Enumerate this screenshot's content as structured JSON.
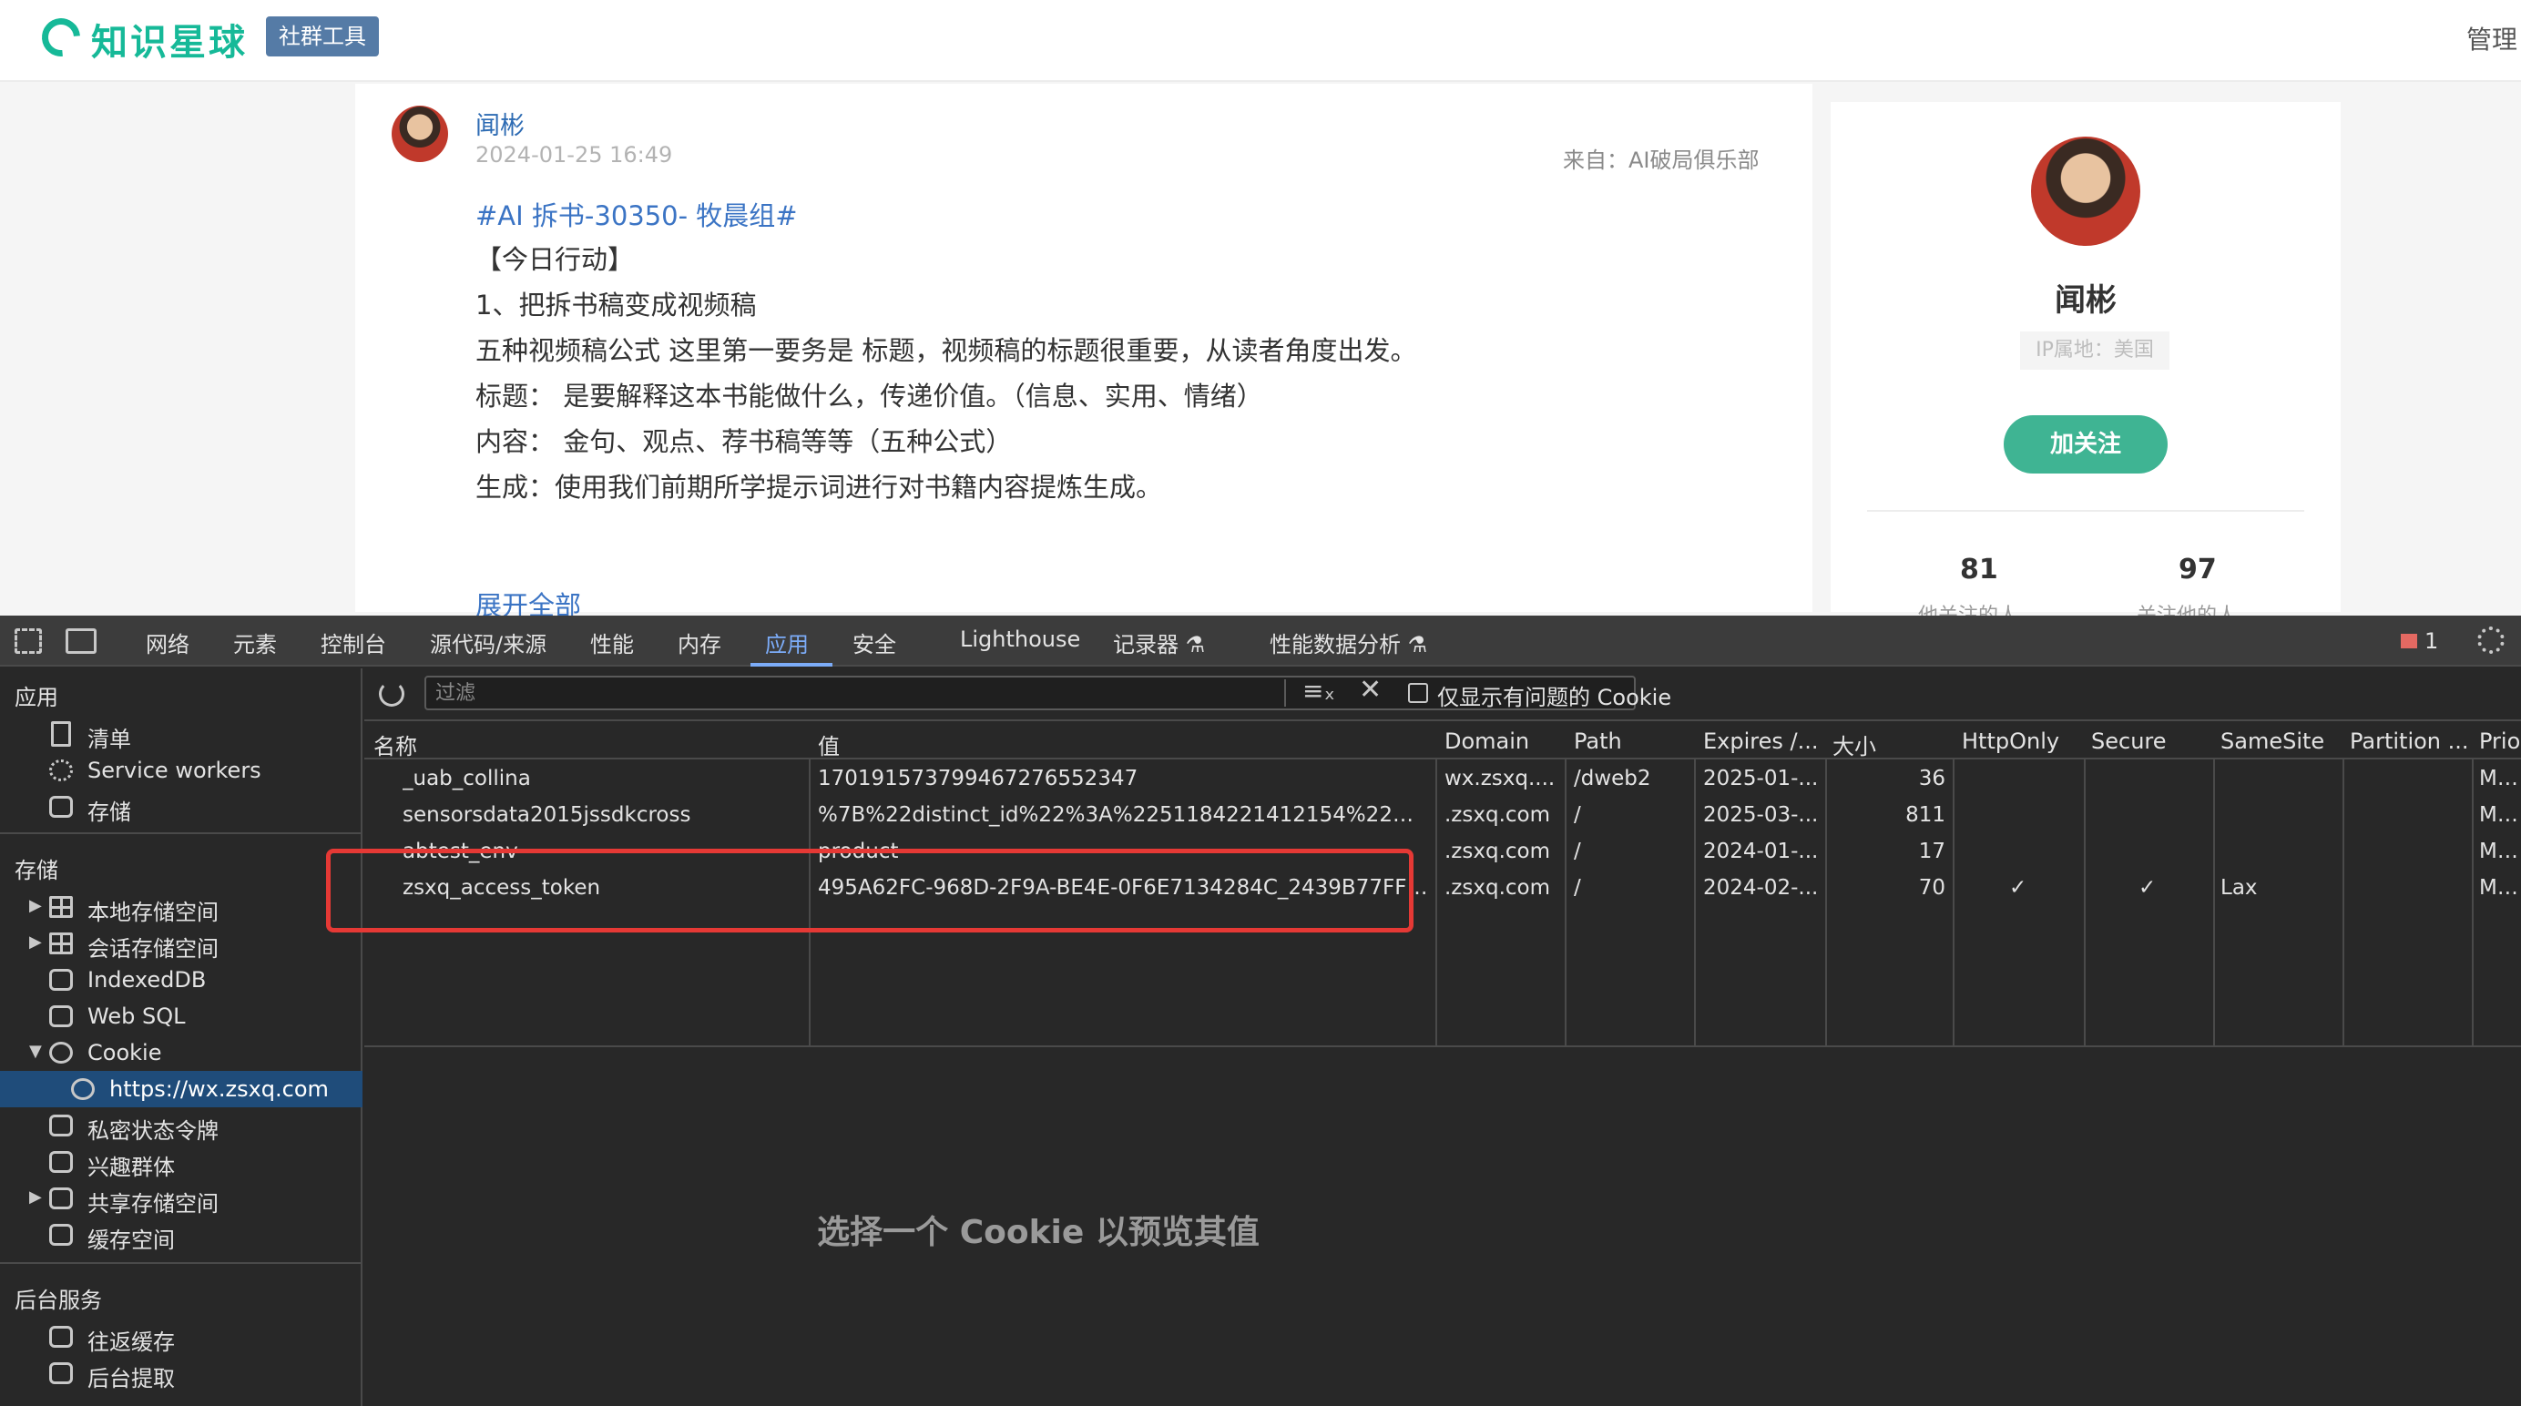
{
  "header": {
    "logo_text": "知识星球",
    "badge": "社群工具",
    "manage": "管理"
  },
  "post": {
    "author": "闻彬",
    "time": "2024-01-25 16:49",
    "source": "来自：AI破局俱乐部",
    "tag": "#AI 拆书-30350- 牧晨组#",
    "lines": [
      "【今日行动】",
      "1、把拆书稿变成视频稿",
      "五种视频稿公式 这里第一要务是 标题，视频稿的标题很重要，从读者角度出发。",
      "标题：  是要解释这本书能做什么，传递价值。（信息、实用、情绪）",
      "内容：  金句、观点、荐书稿等等（五种公式）",
      "生成：使用我们前期所学提示词进行对书籍内容提炼生成。"
    ],
    "expand": "展开全部"
  },
  "profile": {
    "name": "闻彬",
    "ip": "IP属地：美国",
    "follow": "加关注",
    "following_count": "81",
    "following_label": "他关注的人",
    "followers_count": "97",
    "followers_label": "关注他的人"
  },
  "devtools": {
    "tabs": [
      "网络",
      "元素",
      "控制台",
      "源代码/来源",
      "性能",
      "内存",
      "应用",
      "安全",
      "Lighthouse",
      "记录器 ⚗",
      "性能数据分析 ⚗"
    ],
    "active_tab": "应用",
    "issues": "1",
    "sidebar": {
      "app_head": "应用",
      "app_items": [
        "清单",
        "Service workers",
        "存储"
      ],
      "storage_head": "存储",
      "storage_items": [
        "本地存储空间",
        "会话存储空间",
        "IndexedDB",
        "Web SQL",
        "Cookie",
        "https://wx.zsxq.com",
        "私密状态令牌",
        "兴趣群体",
        "共享存储空间",
        "缓存空间"
      ],
      "bg_head": "后台服务",
      "bg_items": [
        "往返缓存",
        "后台提取"
      ]
    },
    "filter_placeholder": "过滤",
    "only_issues_label": "仅显示有问题的 Cookie",
    "columns": [
      "名称",
      "值",
      "Domain",
      "Path",
      "Expires /...",
      "大小",
      "HttpOnly",
      "Secure",
      "SameSite",
      "Partition ...",
      "Prior"
    ],
    "rows": [
      {
        "name": "_uab_collina",
        "value": "170191573799467276552347",
        "domain": "wx.zsxq....",
        "path": "/dweb2",
        "expires": "2025-01-...",
        "size": "36",
        "httponly": "",
        "secure": "",
        "samesite": "",
        "partition": "",
        "priority": "Med"
      },
      {
        "name": "sensorsdata2015jssdkcross",
        "value": "%7B%22distinct_id%22%3A%2251184221412154%22%2...",
        "domain": ".zsxq.com",
        "path": "/",
        "expires": "2025-03-...",
        "size": "811",
        "httponly": "",
        "secure": "",
        "samesite": "",
        "partition": "",
        "priority": "Med"
      },
      {
        "name": "abtest_env",
        "value": "product",
        "domain": ".zsxq.com",
        "path": "/",
        "expires": "2024-01-...",
        "size": "17",
        "httponly": "",
        "secure": "",
        "samesite": "",
        "partition": "",
        "priority": "Med"
      },
      {
        "name": "zsxq_access_token",
        "value": "495A62FC-968D-2F9A-BE4E-0F6E7134284C_2439B77FF1...",
        "domain": ".zsxq.com",
        "path": "/",
        "expires": "2024-02-...",
        "size": "70",
        "httponly": "✓",
        "secure": "✓",
        "samesite": "Lax",
        "partition": "",
        "priority": "Med"
      }
    ],
    "preview_text": "选择一个 Cookie 以预览其值"
  },
  "colors": {
    "brand": "#16b998",
    "follow": "#3fb493",
    "link": "#3b74c4",
    "highlight": "#e53935",
    "selected": "#1f4c7a"
  }
}
